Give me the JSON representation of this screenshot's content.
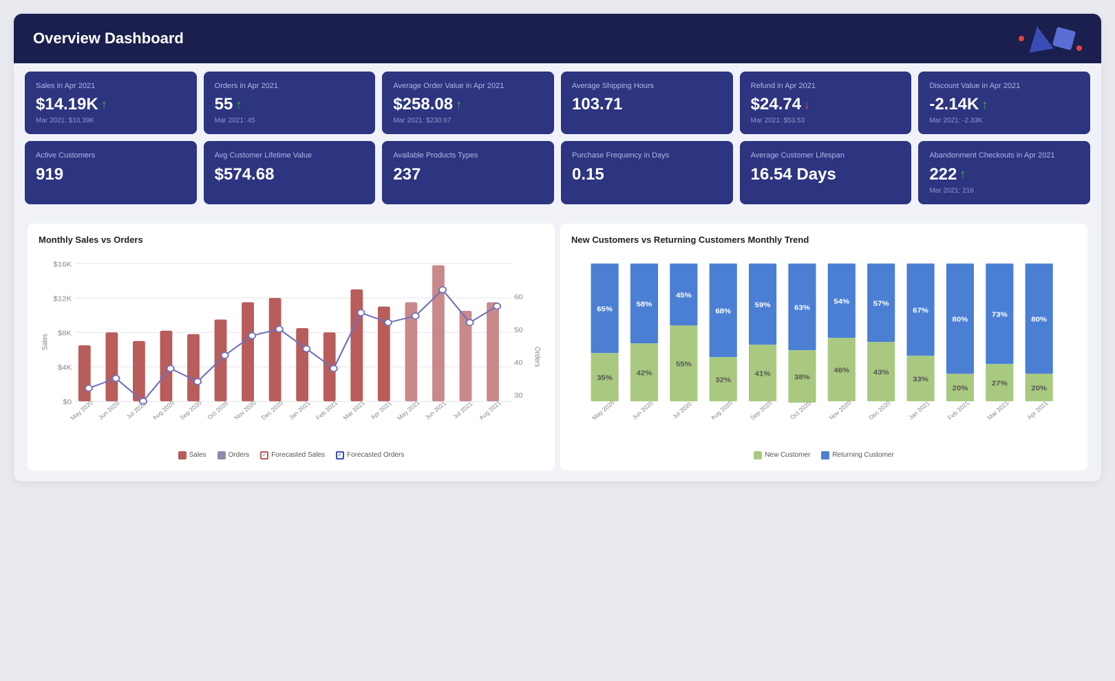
{
  "header": {
    "title": "Overview Dashboard"
  },
  "kpi_row1": [
    {
      "id": "sales-apr",
      "label": "Sales in Apr 2021",
      "value": "$14.19K",
      "trend": "up",
      "sub": "Mar 2021: $10.39K"
    },
    {
      "id": "orders-apr",
      "label": "Orders in Apr 2021",
      "value": "55",
      "trend": "up",
      "sub": "Mar 2021: 45"
    },
    {
      "id": "avg-order-value",
      "label": "Average Order Value in Apr 2021",
      "value": "$258.08",
      "trend": "up",
      "sub": "Mar 2021: $230.97"
    },
    {
      "id": "avg-shipping",
      "label": "Average Shipping Hours",
      "value": "103.71",
      "trend": "none",
      "sub": ""
    },
    {
      "id": "refund-apr",
      "label": "Refund in Apr 2021",
      "value": "$24.74",
      "trend": "down",
      "sub": "Mar 2021: $53.53"
    },
    {
      "id": "discount-apr",
      "label": "Discount Value in Apr 2021",
      "value": "-2.14K",
      "trend": "up",
      "sub": "Mar 2021: -2.33K"
    }
  ],
  "kpi_row2": [
    {
      "id": "active-customers",
      "label": "Active Customers",
      "value": "919",
      "trend": "none",
      "sub": ""
    },
    {
      "id": "avg-lifetime",
      "label": "Avg Customer Lifetime Value",
      "value": "$574.68",
      "trend": "none",
      "sub": ""
    },
    {
      "id": "product-types",
      "label": "Available Products Types",
      "value": "237",
      "trend": "none",
      "sub": ""
    },
    {
      "id": "purchase-freq",
      "label": "Purchase Frequency in Days",
      "value": "0.15",
      "trend": "none",
      "sub": ""
    },
    {
      "id": "avg-lifespan",
      "label": "Average Customer Lifespan",
      "value": "16.54 Days",
      "trend": "none",
      "sub": ""
    },
    {
      "id": "abandonment",
      "label": "Abandonment Checkouts in Apr 2021",
      "value": "222",
      "trend": "up",
      "sub": "Mar 2021: 216"
    }
  ],
  "chart1": {
    "title": "Monthly Sales vs Orders",
    "legend": [
      {
        "label": "Sales",
        "color": "#b85c5c",
        "type": "box"
      },
      {
        "label": "Orders",
        "color": "#8b8bb0",
        "type": "box"
      },
      {
        "label": "Forecasted Sales",
        "color": "#b85c5c",
        "type": "check"
      },
      {
        "label": "Forecasted Orders",
        "color": "#3a4db7",
        "type": "check"
      }
    ],
    "months": [
      "May 2020",
      "Jun 2020",
      "Jul 2020",
      "Aug 2020",
      "Sep 2020",
      "Oct 2020",
      "Nov 2020",
      "Dec 2020",
      "Jan 2021",
      "Feb 2021",
      "Mar 2021",
      "Apr 2021",
      "May 2021",
      "Jun 2021",
      "Jul 2021",
      "Aug 2021"
    ],
    "sales": [
      6500,
      8000,
      7000,
      8200,
      7800,
      9500,
      11500,
      12000,
      8500,
      8000,
      13000,
      11000,
      11500,
      15800,
      10500,
      11500
    ],
    "orders": [
      32,
      35,
      28,
      38,
      34,
      42,
      48,
      50,
      44,
      38,
      55,
      52,
      54,
      62,
      52,
      57
    ],
    "forecasted_sales": [
      null,
      null,
      null,
      null,
      null,
      null,
      null,
      null,
      null,
      null,
      null,
      null,
      11000,
      15000,
      10000,
      11000
    ],
    "forecasted_orders": [
      null,
      null,
      null,
      null,
      null,
      null,
      null,
      null,
      null,
      null,
      null,
      null,
      52,
      60,
      50,
      56
    ]
  },
  "chart2": {
    "title": "New Customers vs Returning Customers Monthly Trend",
    "legend": [
      {
        "label": "New Customer",
        "color": "#a8c97f"
      },
      {
        "label": "Returning Customer",
        "color": "#4a7fd4"
      }
    ],
    "months": [
      "May 2020",
      "Jun 2020",
      "Jul 2020",
      "Aug 2020",
      "Sep 2020",
      "Oct 2020",
      "Nov 2020",
      "Dec 2020",
      "Jan 2021",
      "Feb 2021",
      "Mar 2021",
      "Apr 2021"
    ],
    "new_pct": [
      35,
      42,
      55,
      32,
      41,
      38,
      46,
      43,
      33,
      20,
      27,
      20
    ],
    "returning_pct": [
      65,
      58,
      45,
      68,
      59,
      63,
      54,
      57,
      67,
      80,
      73,
      80
    ]
  }
}
